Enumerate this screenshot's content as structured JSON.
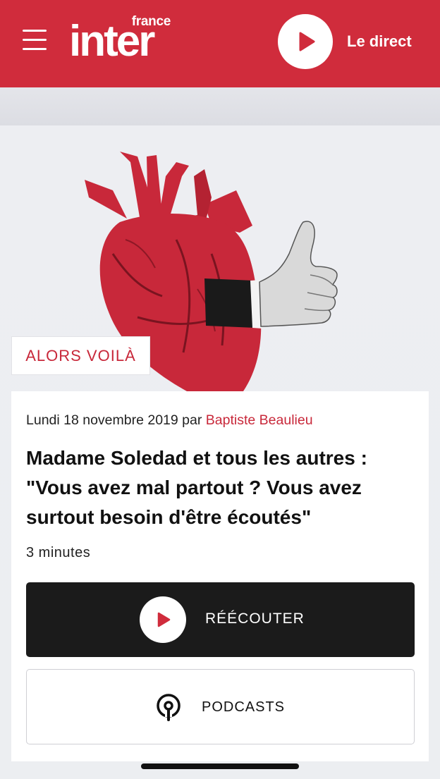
{
  "header": {
    "logo_small": "france",
    "logo_big": "inter",
    "live_label": "Le direct"
  },
  "show": {
    "tag": "ALORS VOILÀ"
  },
  "article": {
    "date": "Lundi 18 novembre 2019",
    "by": "par",
    "author": "Baptiste Beaulieu",
    "title": "Madame Soledad et tous les autres : \"Vous avez mal partout ? Vous avez surtout besoin d'être écoutés\"",
    "duration": "3 minutes",
    "replay_label": "RÉÉCOUTER",
    "podcasts_label": "PODCASTS"
  },
  "colors": {
    "brand_red": "#d02c3c",
    "accent_text_red": "#c8283a",
    "dark_button": "#1b1b1b"
  },
  "icons": {
    "menu": "hamburger-icon",
    "play": "play-icon",
    "podcast": "podcast-icon"
  }
}
